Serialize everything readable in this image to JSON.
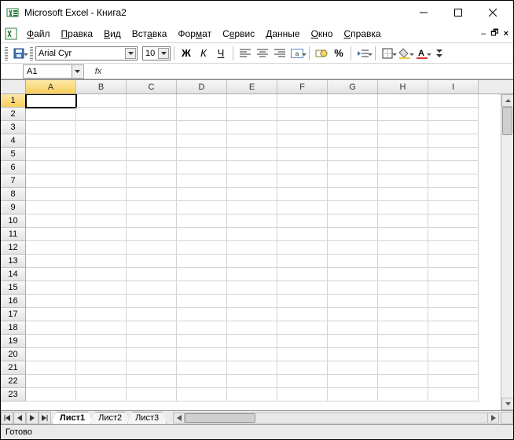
{
  "window": {
    "title": "Microsoft Excel - Книга2"
  },
  "menu": {
    "file": "Файл",
    "edit": "Правка",
    "view": "Вид",
    "insert": "Вставка",
    "format": "Формат",
    "tools": "Сервис",
    "data": "Данные",
    "window": "Окно",
    "help": "Справка"
  },
  "toolbar": {
    "font": "Arial Cyr",
    "font_size": "10",
    "bold": "Ж",
    "italic": "К",
    "underline": "Ч",
    "percent": "%"
  },
  "formula_bar": {
    "name_box": "A1",
    "fx_label": "fx",
    "value": ""
  },
  "grid": {
    "columns": [
      "A",
      "B",
      "C",
      "D",
      "E",
      "F",
      "G",
      "H",
      "I"
    ],
    "rows": [
      "1",
      "2",
      "3",
      "4",
      "5",
      "6",
      "7",
      "8",
      "9",
      "10",
      "11",
      "12",
      "13",
      "14",
      "15",
      "16",
      "17",
      "18",
      "19",
      "20",
      "21",
      "22",
      "23"
    ],
    "active_cell": "A1"
  },
  "sheets": {
    "tabs": [
      "Лист1",
      "Лист2",
      "Лист3"
    ],
    "active": 0
  },
  "status": {
    "text": "Готово"
  }
}
